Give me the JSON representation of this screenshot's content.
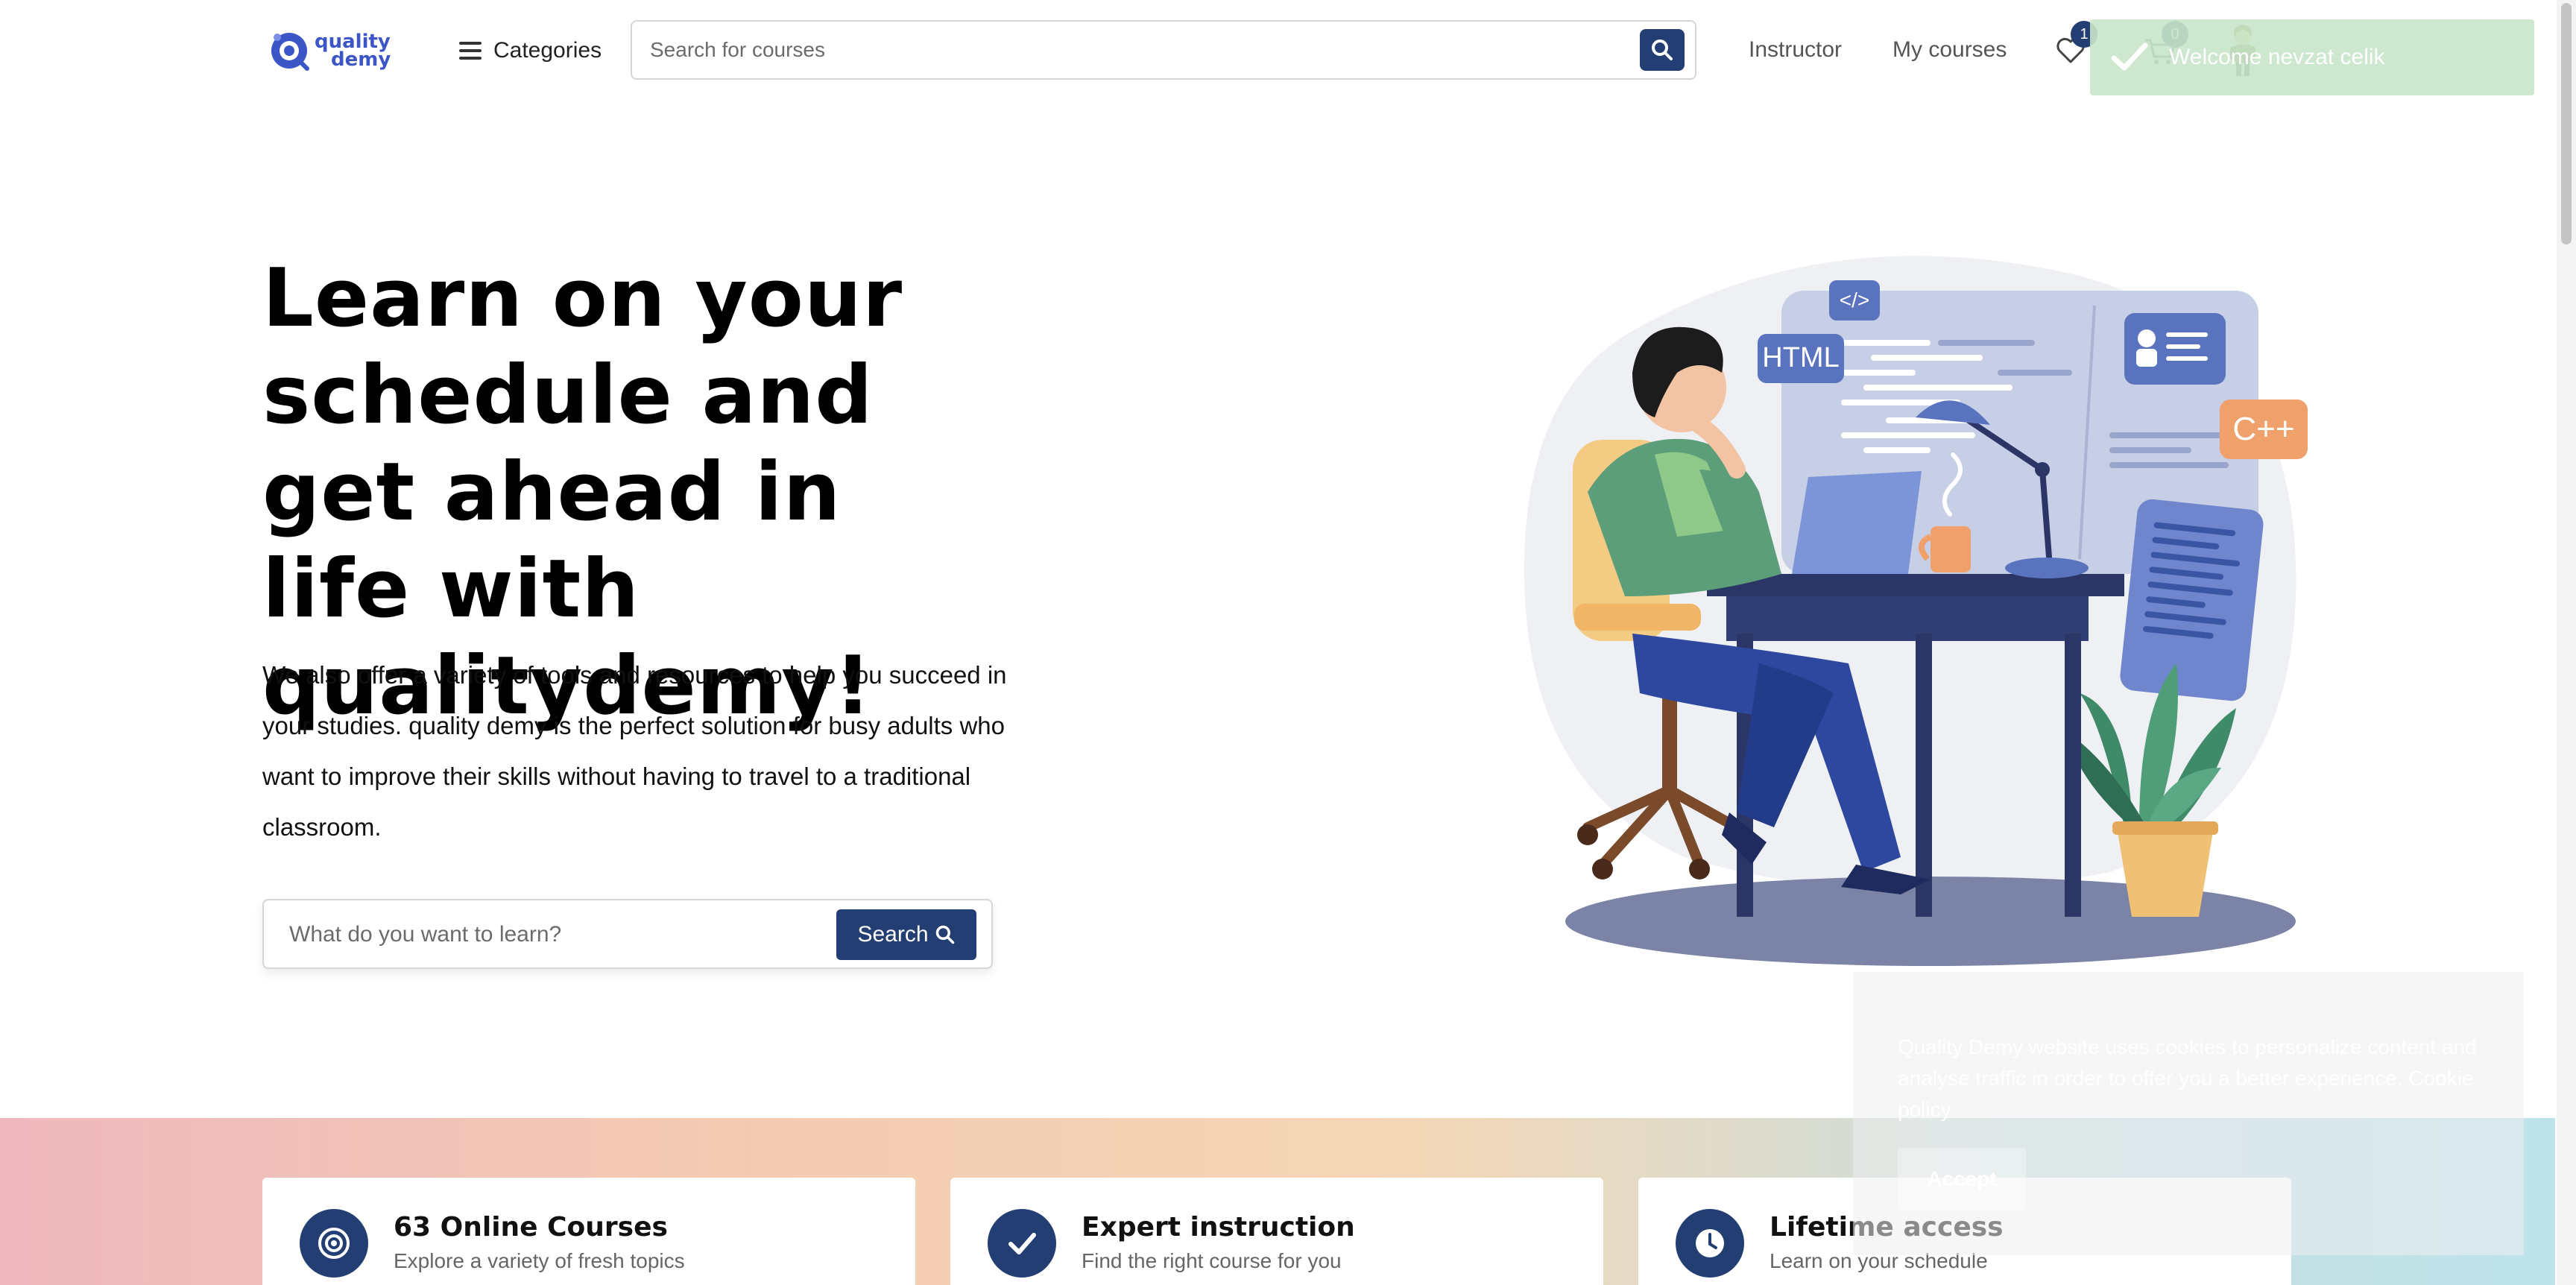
{
  "header": {
    "logo": {
      "line1": "quality",
      "line2": "demy"
    },
    "categories_label": "Categories",
    "search_placeholder": "Search for courses",
    "nav": {
      "instructor": "Instructor",
      "my_courses": "My courses"
    },
    "wishlist_count": "1",
    "cart_count": "0"
  },
  "toast": {
    "message": "Welcome nevzat celik"
  },
  "hero": {
    "title": "Learn on your schedule and get ahead in life with qualitydemy!",
    "description": "We also offer a variety of tools and resources to help you succeed in your studies. quality demy is the perfect solution for busy adults who want to improve their skills without having to travel to a traditional classroom.",
    "search_placeholder": "What do you want to learn?",
    "search_button": "Search"
  },
  "illustration": {
    "tag_html": "HTML",
    "tag_code": "</>",
    "tag_cpp": "C++"
  },
  "features": [
    {
      "title": "63 Online Courses",
      "subtitle": "Explore a variety of fresh topics",
      "icon": "target-icon"
    },
    {
      "title": "Expert instruction",
      "subtitle": "Find the right course for you",
      "icon": "check-icon"
    },
    {
      "title": "Lifetime access",
      "subtitle": "Learn on your schedule",
      "icon": "clock-icon"
    }
  ],
  "cookie": {
    "text": "Quality Demy website uses cookies to personalize content and analyse traffic in order to offer you a better experience.",
    "link": "Cookie policy",
    "accept": "Accept"
  },
  "colors": {
    "primary": "#233e73",
    "logo": "#3d56c7",
    "toast": "#c8e6c9"
  }
}
